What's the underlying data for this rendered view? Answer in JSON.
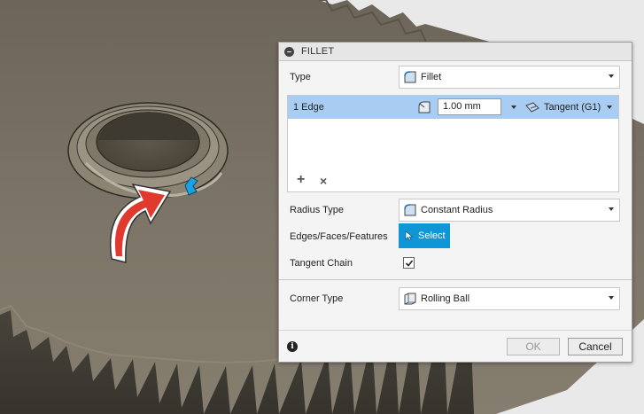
{
  "panel": {
    "title": "FILLET",
    "type_label": "Type",
    "type_value": "Fillet",
    "selection": {
      "edge_label": "1 Edge",
      "radius_value": "1.00 mm",
      "tangency_value": "Tangent (G1)",
      "add_symbol": "+",
      "remove_symbol": "×"
    },
    "radius_type_label": "Radius Type",
    "radius_type_value": "Constant Radius",
    "edges_label": "Edges/Faces/Features",
    "select_button": "Select",
    "tangent_chain_label": "Tangent Chain",
    "tangent_chain_checked": true,
    "corner_type_label": "Corner Type",
    "corner_type_value": "Rolling Ball",
    "info_symbol": "i",
    "ok_label": "OK",
    "cancel_label": "Cancel"
  },
  "colors": {
    "selection_row": "#a9ccf3",
    "select_button": "#0f96d7",
    "arrow_red": "#e03a2f",
    "model_gray": "#7a7263"
  }
}
